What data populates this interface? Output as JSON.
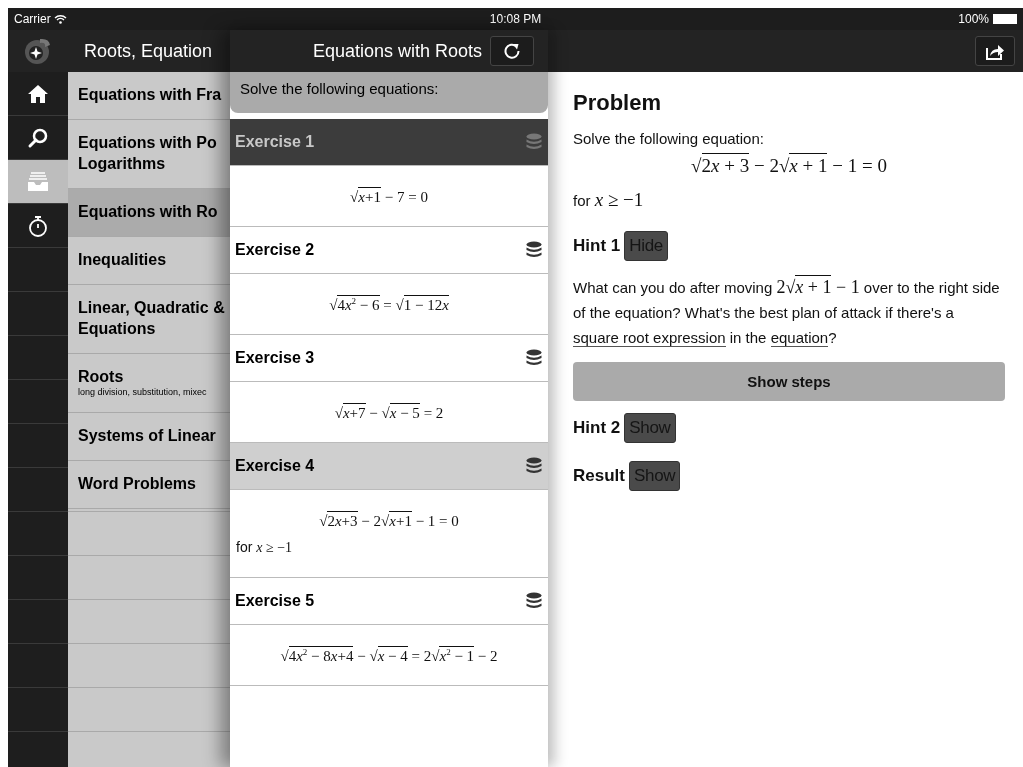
{
  "status_bar": {
    "carrier": "Carrier",
    "time": "10:08 PM",
    "battery": "100%"
  },
  "sidebar_nav": {
    "title": "Roots, Equation",
    "tabs": [
      {
        "selected": false
      },
      {
        "selected": false
      },
      {
        "selected": true
      },
      {
        "selected": false
      }
    ]
  },
  "categories": [
    {
      "lines": [
        "Equations with Fra"
      ],
      "selected": false
    },
    {
      "lines": [
        "Equations with Po",
        "Logarithms"
      ],
      "selected": false
    },
    {
      "lines": [
        "Equations with Ro"
      ],
      "selected": true
    },
    {
      "lines": [
        "Inequalities"
      ],
      "selected": false
    },
    {
      "lines": [
        "Linear, Quadratic &",
        "Equations"
      ],
      "selected": false
    },
    {
      "lines": [
        "Roots"
      ],
      "subtitle": "long division, substitution, mixec",
      "selected": false
    },
    {
      "lines": [
        "Systems of Linear"
      ],
      "selected": false
    },
    {
      "lines": [
        "Word Problems"
      ],
      "selected": false
    }
  ],
  "exercises_panel": {
    "title": "Equations with Roots",
    "intro": "Solve the following equations:",
    "exercises": [
      {
        "title": "Exercise 1",
        "pinned": true,
        "selected": false,
        "lines": [
          [
            {
              "kind": "text",
              "text": "√"
            },
            {
              "kind": "root",
              "parts": [
                {
                  "kind": "var",
                  "text": "x"
                },
                {
                  "kind": "text",
                  "text": "+1"
                }
              ]
            },
            {
              "kind": "text",
              "text": " − 7 = 0"
            }
          ]
        ]
      },
      {
        "title": "Exercise 2",
        "pinned": false,
        "selected": false,
        "lines": [
          [
            {
              "kind": "text",
              "text": "√"
            },
            {
              "kind": "root",
              "parts": [
                {
                  "kind": "text",
                  "text": "4"
                },
                {
                  "kind": "var",
                  "text": "x"
                },
                {
                  "kind": "text",
                  "text": "$^{2}$ − 6"
                }
              ]
            },
            {
              "kind": "text",
              "text": " = √"
            },
            {
              "kind": "root",
              "parts": [
                {
                  "kind": "text",
                  "text": "1 − 12"
                },
                {
                  "kind": "var",
                  "text": "x"
                }
              ]
            }
          ]
        ]
      },
      {
        "title": "Exercise 3",
        "pinned": false,
        "selected": false,
        "lines": [
          [
            {
              "kind": "text",
              "text": "√"
            },
            {
              "kind": "root",
              "parts": [
                {
                  "kind": "var",
                  "text": "x"
                },
                {
                  "kind": "text",
                  "text": "+7"
                }
              ]
            },
            {
              "kind": "text",
              "text": " − √"
            },
            {
              "kind": "root",
              "parts": [
                {
                  "kind": "var",
                  "text": "x"
                },
                {
                  "kind": "text",
                  "text": " − 5"
                }
              ]
            },
            {
              "kind": "text",
              "text": " = 2"
            }
          ]
        ]
      },
      {
        "title": "Exercise 4",
        "pinned": false,
        "selected": true,
        "lines": [
          [
            {
              "kind": "text",
              "text": "√"
            },
            {
              "kind": "root",
              "parts": [
                {
                  "kind": "text",
                  "text": "2"
                },
                {
                  "kind": "var",
                  "text": "x"
                },
                {
                  "kind": "text",
                  "text": "+3"
                }
              ]
            },
            {
              "kind": "text",
              "text": " − 2√"
            },
            {
              "kind": "root",
              "parts": [
                {
                  "kind": "var",
                  "text": "x"
                },
                {
                  "kind": "text",
                  "text": "+1"
                }
              ]
            },
            {
              "kind": "text",
              "text": " − 1 = 0"
            }
          ],
          [
            {
              "kind": "word",
              "text": "for "
            },
            {
              "kind": "var",
              "text": "x"
            },
            {
              "kind": "text",
              "text": " ≥ −1"
            }
          ]
        ]
      },
      {
        "title": "Exercise 5",
        "pinned": false,
        "selected": false,
        "lines": [
          [
            {
              "kind": "text",
              "text": "√"
            },
            {
              "kind": "root",
              "parts": [
                {
                  "kind": "text",
                  "text": "4"
                },
                {
                  "kind": "var",
                  "text": "x"
                },
                {
                  "kind": "text",
                  "text": "$^{2}$ − 8"
                },
                {
                  "kind": "var",
                  "text": "x"
                },
                {
                  "kind": "text",
                  "text": "+4"
                }
              ]
            },
            {
              "kind": "text",
              "text": " − √"
            },
            {
              "kind": "root",
              "parts": [
                {
                  "kind": "var",
                  "text": "x"
                },
                {
                  "kind": "text",
                  "text": " − 4"
                }
              ]
            },
            {
              "kind": "text",
              "text": " = 2√"
            },
            {
              "kind": "root",
              "parts": [
                {
                  "kind": "var",
                  "text": "x"
                },
                {
                  "kind": "text",
                  "text": "$^{2}$ − 1"
                }
              ]
            },
            {
              "kind": "text",
              "text": " − 2"
            }
          ]
        ]
      }
    ]
  },
  "problem": {
    "heading": "Problem",
    "prompt": "Solve the following equation:",
    "equation": [
      {
        "kind": "text",
        "text": "√"
      },
      {
        "kind": "root",
        "parts": [
          {
            "kind": "text",
            "text": "2"
          },
          {
            "kind": "var",
            "text": "x"
          },
          {
            "kind": "text",
            "text": " + 3"
          }
        ]
      },
      {
        "kind": "text",
        "text": " − 2√"
      },
      {
        "kind": "root",
        "parts": [
          {
            "kind": "var",
            "text": "x"
          },
          {
            "kind": "text",
            "text": " + 1"
          }
        ]
      },
      {
        "kind": "text",
        "text": " − 1 = 0"
      }
    ],
    "condition": [
      {
        "kind": "word",
        "text": "for "
      },
      {
        "kind": "var",
        "text": "x"
      },
      {
        "kind": "text",
        "text": " ≥ −1"
      }
    ],
    "hints": [
      {
        "label": "Hint 1",
        "button": "Hide",
        "body": [
          {
            "kind": "word",
            "text": "What can you do after moving "
          },
          {
            "kind": "text",
            "text": "2√"
          },
          {
            "kind": "root",
            "parts": [
              {
                "kind": "var",
                "text": "x"
              },
              {
                "kind": "text",
                "text": " + 1"
              }
            ]
          },
          {
            "kind": "text",
            "text": " − 1"
          },
          {
            "kind": "word",
            "text": " over to the right side of the equation? What's the best plan of attack if there's a "
          },
          {
            "kind": "link",
            "text": "square root expression"
          },
          {
            "kind": "word",
            "text": " in the "
          },
          {
            "kind": "link",
            "text": "equation"
          },
          {
            "kind": "word",
            "text": "?"
          }
        ],
        "steps_button": "Show steps"
      },
      {
        "label": "Hint 2",
        "button": "Show"
      },
      {
        "label": "Result",
        "button": "Show"
      }
    ]
  }
}
